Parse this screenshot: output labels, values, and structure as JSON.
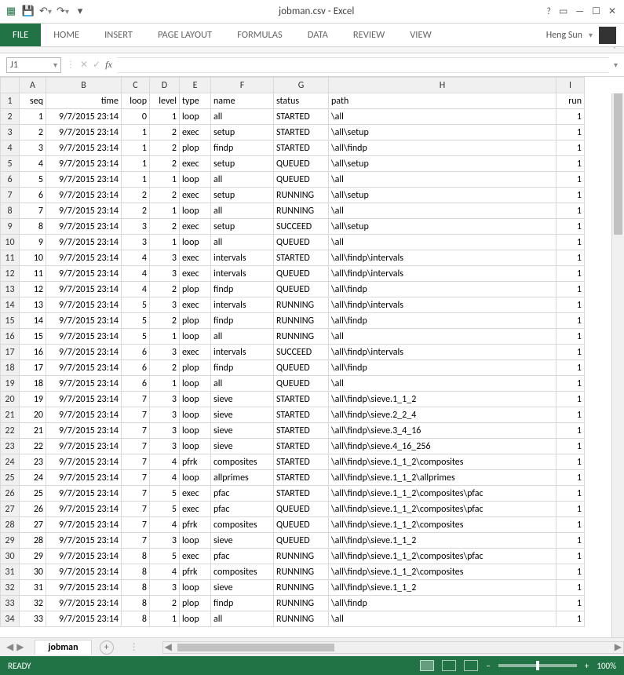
{
  "title": {
    "filename": "jobman.csv",
    "app": "Excel"
  },
  "qat": {
    "excel_icon": "excel-icon",
    "save": "save-icon",
    "undo": "undo-icon",
    "redo": "redo-icon"
  },
  "window_controls": {
    "help": "?",
    "ribbon_opts": "ribbon-display-options",
    "min": "minimize",
    "restore": "restore",
    "close": "close"
  },
  "ribbon": {
    "tabs": [
      "FILE",
      "HOME",
      "INSERT",
      "PAGE LAYOUT",
      "FORMULAS",
      "DATA",
      "REVIEW",
      "VIEW"
    ],
    "active_index": 0,
    "user": "Heng Sun"
  },
  "namebox": {
    "cell": "J1",
    "fx_label": "fx",
    "cancel_icon": "✕",
    "enter_icon": "✓"
  },
  "sheet": {
    "columns": [
      "A",
      "B",
      "C",
      "D",
      "E",
      "F",
      "G",
      "H",
      "I"
    ],
    "header": [
      "seq",
      "time",
      "loop",
      "level",
      "type",
      "name",
      "status",
      "path",
      "run"
    ],
    "rows": [
      {
        "r": 2,
        "seq": 1,
        "time": "9/7/2015 23:14",
        "loop": 0,
        "level": 1,
        "type": "loop",
        "name": "all",
        "status": "STARTED",
        "path": "\\all",
        "run": 1
      },
      {
        "r": 3,
        "seq": 2,
        "time": "9/7/2015 23:14",
        "loop": 1,
        "level": 2,
        "type": "exec",
        "name": "setup",
        "status": "STARTED",
        "path": "\\all\\setup",
        "run": 1
      },
      {
        "r": 4,
        "seq": 3,
        "time": "9/7/2015 23:14",
        "loop": 1,
        "level": 2,
        "type": "plop",
        "name": "findp",
        "status": "STARTED",
        "path": "\\all\\findp",
        "run": 1
      },
      {
        "r": 5,
        "seq": 4,
        "time": "9/7/2015 23:14",
        "loop": 1,
        "level": 2,
        "type": "exec",
        "name": "setup",
        "status": "QUEUED",
        "path": "\\all\\setup",
        "run": 1
      },
      {
        "r": 6,
        "seq": 5,
        "time": "9/7/2015 23:14",
        "loop": 1,
        "level": 1,
        "type": "loop",
        "name": "all",
        "status": "QUEUED",
        "path": "\\all",
        "run": 1
      },
      {
        "r": 7,
        "seq": 6,
        "time": "9/7/2015 23:14",
        "loop": 2,
        "level": 2,
        "type": "exec",
        "name": "setup",
        "status": "RUNNING",
        "path": "\\all\\setup",
        "run": 1
      },
      {
        "r": 8,
        "seq": 7,
        "time": "9/7/2015 23:14",
        "loop": 2,
        "level": 1,
        "type": "loop",
        "name": "all",
        "status": "RUNNING",
        "path": "\\all",
        "run": 1
      },
      {
        "r": 9,
        "seq": 8,
        "time": "9/7/2015 23:14",
        "loop": 3,
        "level": 2,
        "type": "exec",
        "name": "setup",
        "status": "SUCCEED",
        "path": "\\all\\setup",
        "run": 1
      },
      {
        "r": 10,
        "seq": 9,
        "time": "9/7/2015 23:14",
        "loop": 3,
        "level": 1,
        "type": "loop",
        "name": "all",
        "status": "QUEUED",
        "path": "\\all",
        "run": 1
      },
      {
        "r": 11,
        "seq": 10,
        "time": "9/7/2015 23:14",
        "loop": 4,
        "level": 3,
        "type": "exec",
        "name": "intervals",
        "status": "STARTED",
        "path": "\\all\\findp\\intervals",
        "run": 1
      },
      {
        "r": 12,
        "seq": 11,
        "time": "9/7/2015 23:14",
        "loop": 4,
        "level": 3,
        "type": "exec",
        "name": "intervals",
        "status": "QUEUED",
        "path": "\\all\\findp\\intervals",
        "run": 1
      },
      {
        "r": 13,
        "seq": 12,
        "time": "9/7/2015 23:14",
        "loop": 4,
        "level": 2,
        "type": "plop",
        "name": "findp",
        "status": "QUEUED",
        "path": "\\all\\findp",
        "run": 1
      },
      {
        "r": 14,
        "seq": 13,
        "time": "9/7/2015 23:14",
        "loop": 5,
        "level": 3,
        "type": "exec",
        "name": "intervals",
        "status": "RUNNING",
        "path": "\\all\\findp\\intervals",
        "run": 1
      },
      {
        "r": 15,
        "seq": 14,
        "time": "9/7/2015 23:14",
        "loop": 5,
        "level": 2,
        "type": "plop",
        "name": "findp",
        "status": "RUNNING",
        "path": "\\all\\findp",
        "run": 1
      },
      {
        "r": 16,
        "seq": 15,
        "time": "9/7/2015 23:14",
        "loop": 5,
        "level": 1,
        "type": "loop",
        "name": "all",
        "status": "RUNNING",
        "path": "\\all",
        "run": 1
      },
      {
        "r": 17,
        "seq": 16,
        "time": "9/7/2015 23:14",
        "loop": 6,
        "level": 3,
        "type": "exec",
        "name": "intervals",
        "status": "SUCCEED",
        "path": "\\all\\findp\\intervals",
        "run": 1
      },
      {
        "r": 18,
        "seq": 17,
        "time": "9/7/2015 23:14",
        "loop": 6,
        "level": 2,
        "type": "plop",
        "name": "findp",
        "status": "QUEUED",
        "path": "\\all\\findp",
        "run": 1
      },
      {
        "r": 19,
        "seq": 18,
        "time": "9/7/2015 23:14",
        "loop": 6,
        "level": 1,
        "type": "loop",
        "name": "all",
        "status": "QUEUED",
        "path": "\\all",
        "run": 1
      },
      {
        "r": 20,
        "seq": 19,
        "time": "9/7/2015 23:14",
        "loop": 7,
        "level": 3,
        "type": "loop",
        "name": "sieve",
        "status": "STARTED",
        "path": "\\all\\findp\\sieve.1_1_2",
        "run": 1
      },
      {
        "r": 21,
        "seq": 20,
        "time": "9/7/2015 23:14",
        "loop": 7,
        "level": 3,
        "type": "loop",
        "name": "sieve",
        "status": "STARTED",
        "path": "\\all\\findp\\sieve.2_2_4",
        "run": 1
      },
      {
        "r": 22,
        "seq": 21,
        "time": "9/7/2015 23:14",
        "loop": 7,
        "level": 3,
        "type": "loop",
        "name": "sieve",
        "status": "STARTED",
        "path": "\\all\\findp\\sieve.3_4_16",
        "run": 1
      },
      {
        "r": 23,
        "seq": 22,
        "time": "9/7/2015 23:14",
        "loop": 7,
        "level": 3,
        "type": "loop",
        "name": "sieve",
        "status": "STARTED",
        "path": "\\all\\findp\\sieve.4_16_256",
        "run": 1
      },
      {
        "r": 24,
        "seq": 23,
        "time": "9/7/2015 23:14",
        "loop": 7,
        "level": 4,
        "type": "pfrk",
        "name": "composites",
        "status": "STARTED",
        "path": "\\all\\findp\\sieve.1_1_2\\composites",
        "run": 1
      },
      {
        "r": 25,
        "seq": 24,
        "time": "9/7/2015 23:14",
        "loop": 7,
        "level": 4,
        "type": "loop",
        "name": "allprimes",
        "status": "STARTED",
        "path": "\\all\\findp\\sieve.1_1_2\\allprimes",
        "run": 1
      },
      {
        "r": 26,
        "seq": 25,
        "time": "9/7/2015 23:14",
        "loop": 7,
        "level": 5,
        "type": "exec",
        "name": "pfac",
        "status": "STARTED",
        "path": "\\all\\findp\\sieve.1_1_2\\composites\\pfac",
        "run": 1
      },
      {
        "r": 27,
        "seq": 26,
        "time": "9/7/2015 23:14",
        "loop": 7,
        "level": 5,
        "type": "exec",
        "name": "pfac",
        "status": "QUEUED",
        "path": "\\all\\findp\\sieve.1_1_2\\composites\\pfac",
        "run": 1
      },
      {
        "r": 28,
        "seq": 27,
        "time": "9/7/2015 23:14",
        "loop": 7,
        "level": 4,
        "type": "pfrk",
        "name": "composites",
        "status": "QUEUED",
        "path": "\\all\\findp\\sieve.1_1_2\\composites",
        "run": 1
      },
      {
        "r": 29,
        "seq": 28,
        "time": "9/7/2015 23:14",
        "loop": 7,
        "level": 3,
        "type": "loop",
        "name": "sieve",
        "status": "QUEUED",
        "path": "\\all\\findp\\sieve.1_1_2",
        "run": 1
      },
      {
        "r": 30,
        "seq": 29,
        "time": "9/7/2015 23:14",
        "loop": 8,
        "level": 5,
        "type": "exec",
        "name": "pfac",
        "status": "RUNNING",
        "path": "\\all\\findp\\sieve.1_1_2\\composites\\pfac",
        "run": 1
      },
      {
        "r": 31,
        "seq": 30,
        "time": "9/7/2015 23:14",
        "loop": 8,
        "level": 4,
        "type": "pfrk",
        "name": "composites",
        "status": "RUNNING",
        "path": "\\all\\findp\\sieve.1_1_2\\composites",
        "run": 1
      },
      {
        "r": 32,
        "seq": 31,
        "time": "9/7/2015 23:14",
        "loop": 8,
        "level": 3,
        "type": "loop",
        "name": "sieve",
        "status": "RUNNING",
        "path": "\\all\\findp\\sieve.1_1_2",
        "run": 1
      },
      {
        "r": 33,
        "seq": 32,
        "time": "9/7/2015 23:14",
        "loop": 8,
        "level": 2,
        "type": "plop",
        "name": "findp",
        "status": "RUNNING",
        "path": "\\all\\findp",
        "run": 1
      },
      {
        "r": 34,
        "seq": 33,
        "time": "9/7/2015 23:14",
        "loop": 8,
        "level": 1,
        "type": "loop",
        "name": "all",
        "status": "RUNNING",
        "path": "\\all",
        "run": 1
      }
    ],
    "active_tab": "jobman",
    "add_sheet_label": "+"
  },
  "status": {
    "ready": "READY",
    "zoom": "100%",
    "zoom_minus": "−",
    "zoom_plus": "+"
  }
}
